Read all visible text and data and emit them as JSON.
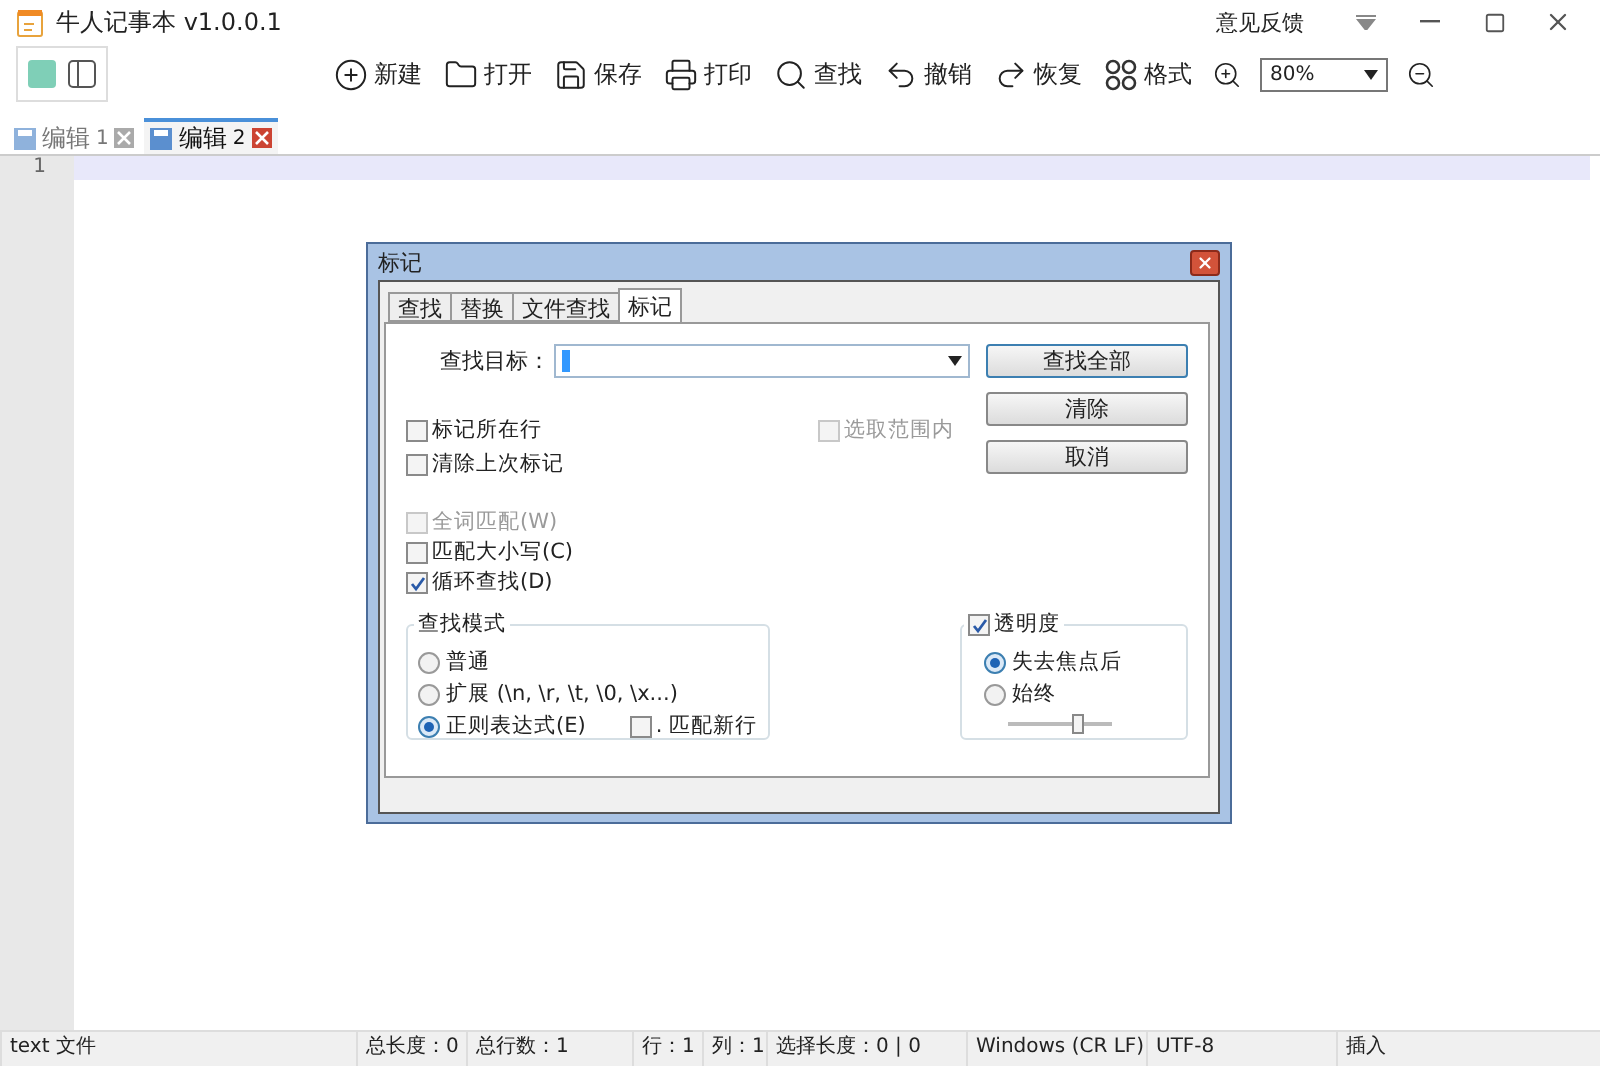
{
  "app": {
    "title": "牛人记事本 v1.0.0.1",
    "feedback": "意见反馈"
  },
  "toolbar": [
    {
      "kind": "new",
      "label": "新建"
    },
    {
      "kind": "open",
      "label": "打开"
    },
    {
      "kind": "save",
      "label": "保存"
    },
    {
      "kind": "print",
      "label": "打印"
    },
    {
      "kind": "find",
      "label": "查找"
    },
    {
      "kind": "undo",
      "label": "撤销"
    },
    {
      "kind": "redo",
      "label": "恢复"
    },
    {
      "kind": "format",
      "label": "格式"
    }
  ],
  "zoom": {
    "value": "80%"
  },
  "doc_tabs": [
    {
      "label": "编辑",
      "number": "1",
      "selected": false
    },
    {
      "label": "编辑",
      "number": "2",
      "selected": true
    }
  ],
  "editor": {
    "line_numbers": [
      "1"
    ]
  },
  "dialog": {
    "title": "标记",
    "tabs": [
      {
        "label": "查找",
        "selected": false
      },
      {
        "label": "替换",
        "selected": false
      },
      {
        "label": "文件查找",
        "selected": false
      },
      {
        "label": "标记",
        "selected": true
      }
    ],
    "find_target_label": "查找目标：",
    "buttons": [
      "查找全部",
      "清除",
      "取消"
    ],
    "mark_options": [
      {
        "label": "标记所在行",
        "checked": false,
        "disabled": false
      },
      {
        "label": "清除上次标记",
        "checked": false,
        "disabled": false
      }
    ],
    "in_selection": {
      "label": "选取范围内",
      "checked": false,
      "disabled": true
    },
    "match_options": [
      {
        "label": "全词匹配(W)",
        "checked": false,
        "disabled": true
      },
      {
        "label": "匹配大小写(C)",
        "checked": false,
        "disabled": false
      },
      {
        "label": "循环查找(D)",
        "checked": true,
        "disabled": false
      }
    ],
    "search_mode": {
      "title": "查找模式",
      "modes": [
        {
          "label": "普通",
          "selected": false
        },
        {
          "label": "扩展 (\\n, \\r, \\t, \\0, \\x...)",
          "selected": false
        },
        {
          "label": "正则表达式(E)",
          "selected": true
        }
      ],
      "dot_newline": {
        "label": ". 匹配新行",
        "checked": false
      }
    },
    "transparency": {
      "label": "透明度",
      "checked": true,
      "modes": [
        {
          "label": "失去焦点后",
          "selected": true
        },
        {
          "label": "始终",
          "selected": false
        }
      ],
      "level": 0.7
    }
  },
  "status_bar": [
    "text 文件",
    "总长度：0",
    "总行数：1",
    "行：1",
    "列：1",
    "选择长度：0 | 0",
    "Windows (CR LF)",
    "UTF-8",
    "插入"
  ]
}
